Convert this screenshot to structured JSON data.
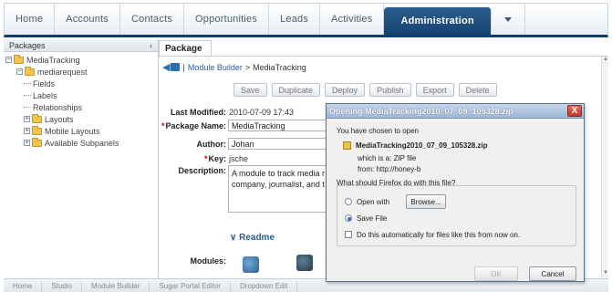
{
  "topnav": {
    "tabs": [
      "Home",
      "Accounts",
      "Contacts",
      "Opportunities",
      "Leads",
      "Activities",
      "Administration"
    ],
    "active": "Administration"
  },
  "packages_panel": {
    "title": "Packages",
    "collapse": "‹",
    "tree": [
      {
        "label": "MediaTracking",
        "level": 0,
        "toggle": "⊟",
        "folder": true
      },
      {
        "label": "mediarequest",
        "level": 1,
        "toggle": "⊟",
        "folder": true
      },
      {
        "label": "Fields",
        "level": 2
      },
      {
        "label": "Labels",
        "level": 2
      },
      {
        "label": "Relationships",
        "level": 2
      },
      {
        "label": "Layouts",
        "level": 1,
        "toggle": "⊞",
        "folder": true
      },
      {
        "label": "Mobile Layouts",
        "level": 1,
        "toggle": "⊞",
        "folder": true
      },
      {
        "label": "Available Subpanels",
        "level": 1,
        "toggle": "⊞",
        "folder": true
      }
    ]
  },
  "package_tab": "Package",
  "breadcrumb": {
    "separator": "|",
    "module_builder": "Module Builder",
    "arrow": ">",
    "current": "MediaTracking"
  },
  "actions": [
    "Save",
    "Duplicate",
    "Deploy",
    "Publish",
    "Export",
    "Delete"
  ],
  "form": {
    "last_modified_label": "Last Modified:",
    "last_modified_value": "2010-07-09 17:43",
    "package_name_label": "Package Name:",
    "package_name_value": "MediaTracking",
    "author_label": "Author:",
    "author_value": "Johan",
    "key_label": "Key:",
    "key_value": "jsche",
    "description_label": "Description:",
    "description_value": "A module to track media r company, journalist, and t",
    "readme": "∨ Readme",
    "modules_label": "Modules:"
  },
  "bottom_tabs": [
    "Home",
    "Studio",
    "Module Builder",
    "Sugar Portal Editor",
    "Dropdown Edit"
  ],
  "dialog": {
    "title": "Opening MediaTracking2010_07_09_105328.zip",
    "intro": "You have chosen to open",
    "filename": "MediaTracking2010_07_09_105328.zip",
    "which_is": "which is a:  ZIP file",
    "from": "from:  http://honey-b",
    "question": "What should Firefox do with this file?",
    "open_with": "Open with",
    "browse": "Browse...",
    "save_file": "Save File",
    "auto": "Do this automatically for files like this from now on.",
    "ok": "OK",
    "cancel": "Cancel",
    "close": "X",
    "selected_option": "save_file"
  },
  "colors": {
    "nav_active": "#164472",
    "link": "#2a5d92",
    "dialog_title": "#9db8da",
    "close_red": "#c2392a"
  }
}
